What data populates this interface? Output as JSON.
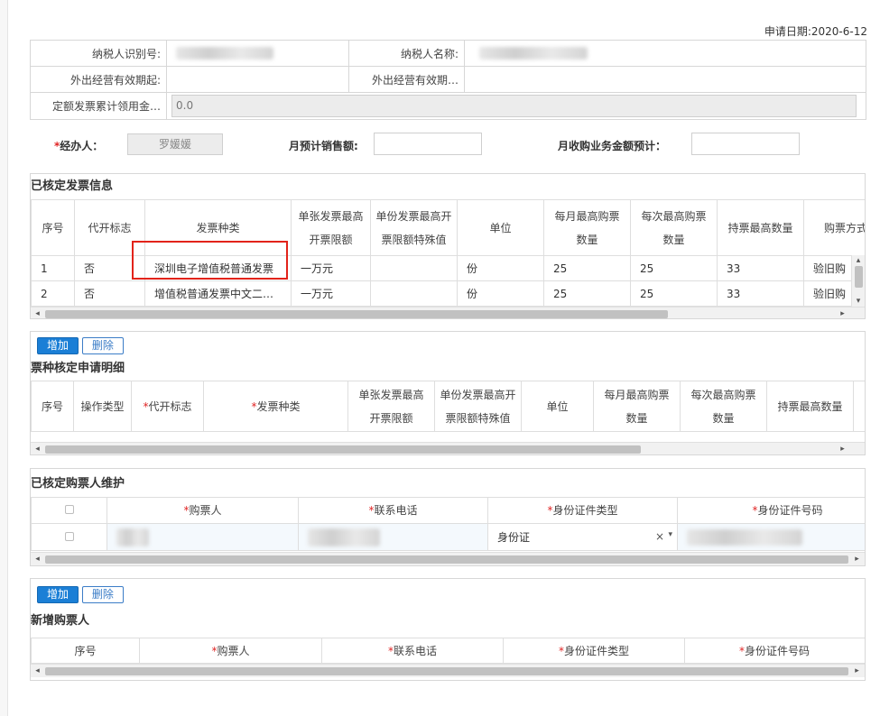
{
  "header": {
    "banner_title": "",
    "apply_date_label": "申请日期:",
    "apply_date": "2020-6-12"
  },
  "taxpayer": {
    "id_label": "纳税人识别号:",
    "id_value": "",
    "name_label": "纳税人名称:",
    "name_value": "",
    "out_start_label": "外出经营有效期起:",
    "out_start_value": "",
    "out_end_label": "外出经营有效期…",
    "out_end_value": "",
    "quota_label": "定额发票累计领用金…",
    "quota_value": "0.0"
  },
  "agent": {
    "star": "*",
    "agent_label": "经办人：",
    "agent_value": "罗媛媛",
    "monthly_sales_label": "月预计销售额:",
    "monthly_sales_value": "",
    "monthly_purchase_label": "月收购业务金额预计：",
    "monthly_purchase_value": ""
  },
  "approved_invoices": {
    "title": "已核定发票信息",
    "columns": {
      "seq": "序号",
      "agent_flag": "代开标志",
      "invoice_type": "发票种类",
      "max_single_1": "单张发票最高",
      "max_single_2": "开票限额",
      "max_special_1": "单份发票最高开",
      "max_special_2": "票限额特殊值",
      "unit": "单位",
      "monthly_max_1": "每月最高购票",
      "monthly_max_2": "数量",
      "each_max_1": "每次最高购票",
      "each_max_2": "数量",
      "hold_max": "持票最高数量",
      "purchase_method": "购票方式"
    },
    "rows": [
      {
        "seq": "1",
        "agent_flag": "否",
        "invoice_type": "深圳电子增值税普通发票",
        "max_single": "一万元",
        "max_special": "",
        "unit": "份",
        "monthly_max": "25",
        "each_max": "25",
        "hold_max": "33",
        "purchase_method": "验旧购"
      },
      {
        "seq": "2",
        "agent_flag": "否",
        "invoice_type": "增值税普通发票中文二…",
        "max_single": "一万元",
        "max_special": "",
        "unit": "份",
        "monthly_max": "25",
        "each_max": "25",
        "hold_max": "33",
        "purchase_method": "验旧购"
      }
    ]
  },
  "apply_detail": {
    "add_label": "增加",
    "delete_label": "删除",
    "title": "票种核定申请明细",
    "columns": {
      "seq": "序号",
      "op_type": "操作类型",
      "agent_flag": "代开标志",
      "invoice_type": "发票种类",
      "max_single_1": "单张发票最高",
      "max_single_2": "开票限额",
      "max_special_1": "单份发票最高开",
      "max_special_2": "票限额特殊值",
      "unit": "单位",
      "monthly_max_1": "每月最高购票",
      "monthly_max_2": "数量",
      "each_max_1": "每次最高购票",
      "each_max_2": "数量",
      "hold_max": "持票最高数量"
    },
    "required_mark": "*"
  },
  "purchasers": {
    "title": "已核定购票人维护",
    "columns": {
      "purchaser": "购票人",
      "phone": "联系电话",
      "id_type": "身份证件类型",
      "id_number": "身份证件号码"
    },
    "required_mark": "*",
    "rows": [
      {
        "purchaser": "",
        "phone": "",
        "id_type": "身份证",
        "id_number": ""
      }
    ],
    "clear_glyph": "×",
    "dropdown_glyph": "▾"
  },
  "new_purchasers": {
    "add_label": "增加",
    "delete_label": "删除",
    "title": "新增购票人",
    "columns": {
      "seq": "序号",
      "purchaser": "购票人",
      "phone": "联系电话",
      "id_type": "身份证件类型",
      "id_number": "身份证件号码"
    },
    "required_mark": "*"
  },
  "scroll_glyphs": {
    "left": "◂",
    "right": "▸",
    "up": "▴",
    "down": "▾"
  },
  "colors": {
    "primary": "#1b7fd6",
    "required": "#e02424",
    "highlight": "#e2231a"
  }
}
